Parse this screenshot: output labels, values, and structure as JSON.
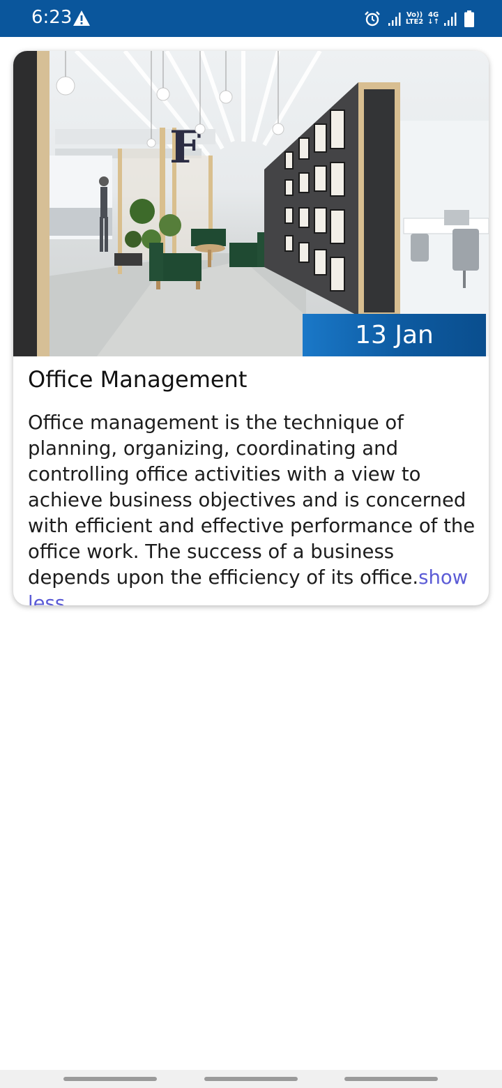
{
  "status_bar": {
    "time": "6:23",
    "network_top": "Vo))",
    "network_bottom": "LTE2",
    "data_type": "4G",
    "icons": [
      "warning-icon",
      "alarm-icon",
      "signal-icon",
      "signal-icon",
      "battery-icon"
    ],
    "background_color": "#0a569c"
  },
  "card": {
    "image_alt": "Office interior with green lounge chairs and framed pictures on wall",
    "date": "13 Jan",
    "title": "Office Management",
    "body": "Office management is the technique of planning, organizing, coordinating and controlling office activities with a view to achieve business objectives and is concerned with efficient and effective performance of the office work. The success of a business depends upon the efficiency of its office.",
    "show_less_label": "show less",
    "accent_color": "#5b5bd6",
    "badge_color": "#0d5aa0"
  }
}
